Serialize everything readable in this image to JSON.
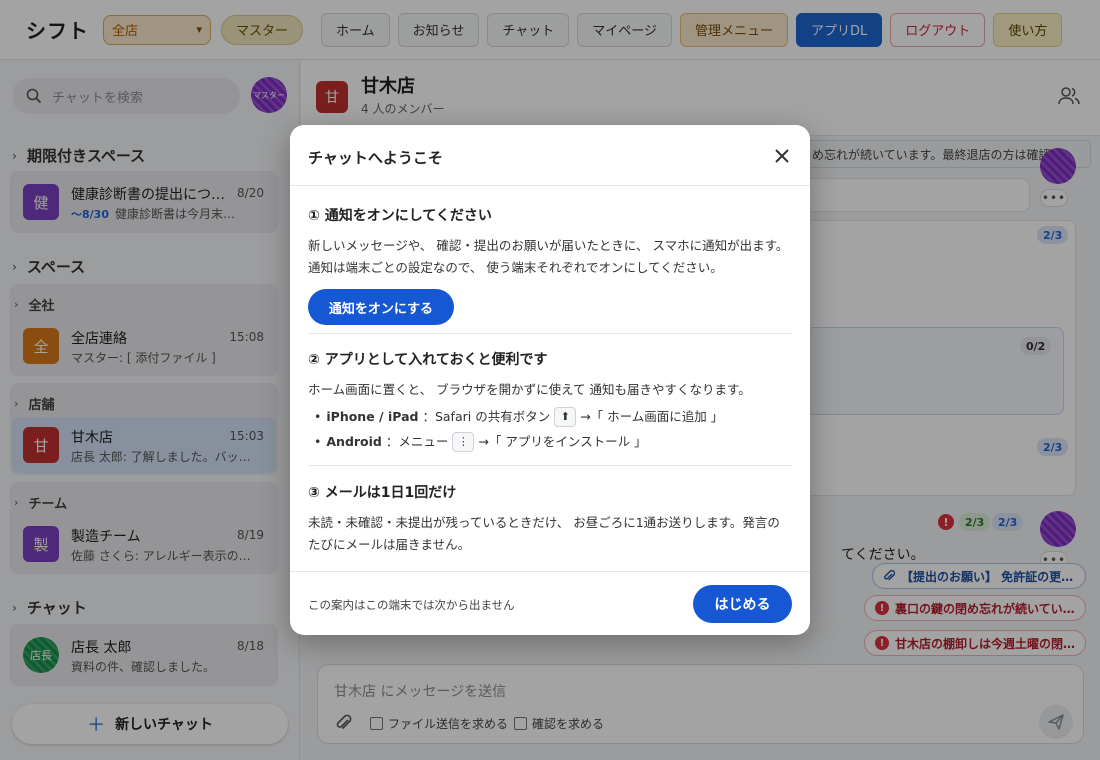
{
  "topbar": {
    "app_title": "シフト",
    "store_select": "全店",
    "role_badge": "マスター",
    "nav": [
      "ホーム",
      "お知らせ",
      "チャット",
      "マイページ",
      "管理メニュー",
      "アプリDL",
      "ログアウト",
      "使い方"
    ]
  },
  "sidebar": {
    "search_placeholder": "チャットを検索",
    "me_avatar_label": "マスター",
    "sections": {
      "limited": "期限付きスペース",
      "spaces": "スペース",
      "chats": "チャット"
    },
    "limited_room": {
      "avatar": "健",
      "name": "健康診断書の提出につ…",
      "time": "8/20",
      "deadline": "〜8/30",
      "last": "健康診断書は今月末…"
    },
    "groups": {
      "all": "全社",
      "stores": "店舗",
      "team": "チーム"
    },
    "rooms": {
      "all_store": {
        "avatar": "全",
        "name": "全店連絡",
        "time": "15:08",
        "last": "マスター: [ 添付ファイル ]"
      },
      "amaki": {
        "avatar": "甘",
        "name": "甘木店",
        "time": "15:03",
        "last": "店長 太郎: 了解しました。バッ…"
      },
      "manufacturing": {
        "avatar": "製",
        "name": "製造チーム",
        "time": "8/19",
        "last": "佐藤 さくら: アレルギー表示の…"
      },
      "manager": {
        "avatar": "店長",
        "name": "店長 太郎",
        "time": "8/18",
        "last": "資料の件、確認しました。"
      }
    },
    "new_chat": "新しいチャット"
  },
  "chat": {
    "header": {
      "avatar": "甘",
      "title": "甘木店",
      "members": "4 人のメンバー"
    },
    "announcement": "め忘れが続いています。最終退店の方は確認を…",
    "badges": [
      "2/3",
      "0/2",
      "2/3",
      "2/3",
      "2/3"
    ],
    "visible_message_fragment": "てください。",
    "pinned": [
      "【提出のお願い】 免許証の更…",
      "裏口の鍵の閉め忘れが続いてい…",
      "甘木店の棚卸しは今週土曜の閉…"
    ],
    "composer": {
      "placeholder": "甘木店 にメッセージを送信",
      "require_file": "ファイル送信を求める",
      "require_confirm": "確認を求める"
    }
  },
  "modal": {
    "title": "チャットへようこそ",
    "step1": {
      "title": "① 通知をオンにしてください",
      "body": "新しいメッセージや、 確認・提出のお願いが届いたときに、 スマホに通知が出ます。 通知は端末ごとの設定なので、 使う端末それぞれでオンにしてください。",
      "button": "通知をオンにする"
    },
    "step2": {
      "title": "② アプリとして入れておくと便利です",
      "body": "ホーム画面に置くと、 ブラウザを開かずに使えて 通知も届きやすくなります。",
      "ios_label": "iPhone / iPad",
      "ios_text_before": "：Safari の共有ボタン",
      "ios_key": "⬆",
      "ios_text_after": "→「 ホーム画面に追加 」",
      "android_label": "Android",
      "android_text_before": "：メニュー",
      "android_key": "⋮",
      "android_text_after": "→「 アプリをインストール 」"
    },
    "step3": {
      "title": "③ メールは1日1回だけ",
      "body": "未読・未確認・未提出が残っているときだけ、 お昼ごろに1通お送りします。発言のたびにメールは届きません。"
    },
    "footer_note": "この案内はこの端末では次から出ません",
    "start_button": "はじめる"
  },
  "colors": {
    "primary": "#1658d4",
    "danger": "#c8283a",
    "overlay": "rgba(0,0,0,0.36)"
  }
}
